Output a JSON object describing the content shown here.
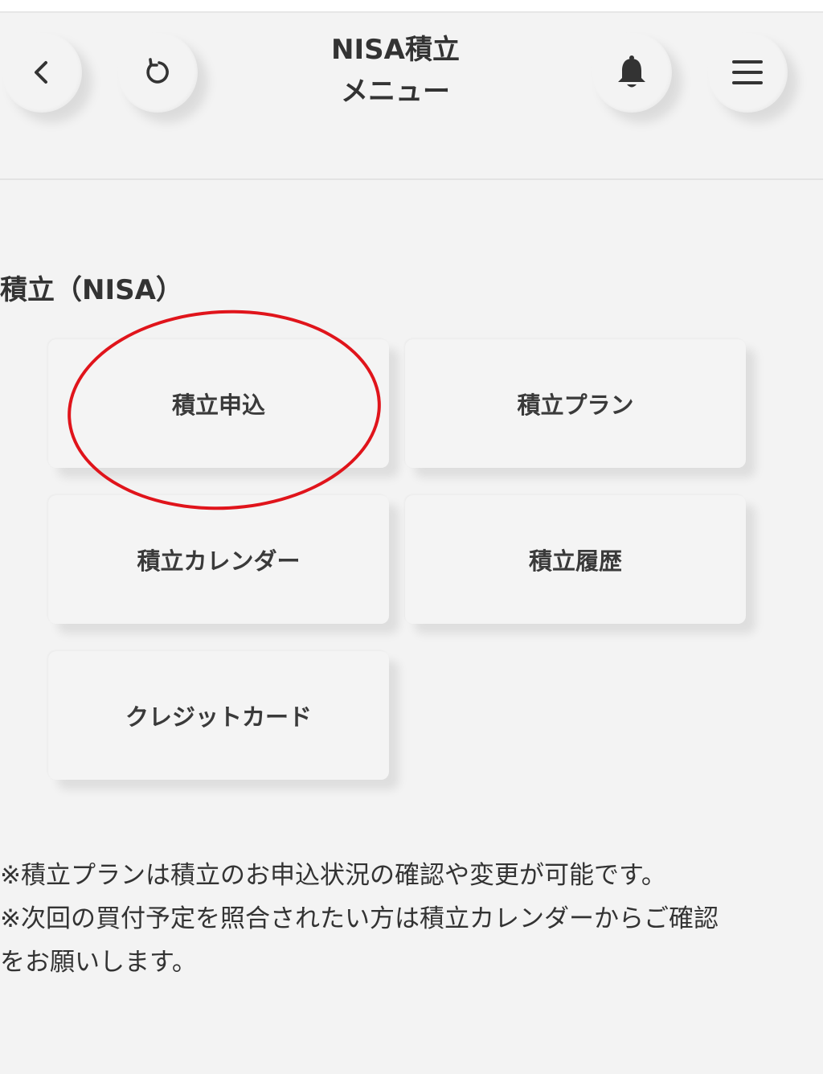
{
  "header": {
    "title_line1": "NISA積立",
    "title_line2": "メニュー",
    "back_icon": "chevron-left-icon",
    "refresh_icon": "refresh-icon",
    "bell_icon": "bell-icon",
    "menu_icon": "hamburger-menu-icon"
  },
  "section": {
    "title": "積立（NISA）"
  },
  "tiles": {
    "apply": "積立申込",
    "plan": "積立プラン",
    "calendar": "積立カレンダー",
    "history": "積立履歴",
    "credit_card": "クレジットカード"
  },
  "notes": {
    "line1": "※積立プランは積立のお申込状況の確認や変更が可能です。",
    "line2": "※次回の買付予定を照合されたい方は積立カレンダーからご確認",
    "line3": "をお願いします。"
  },
  "colors": {
    "background": "#f3f3f3",
    "text": "#333333",
    "highlight": "#e0141b"
  }
}
